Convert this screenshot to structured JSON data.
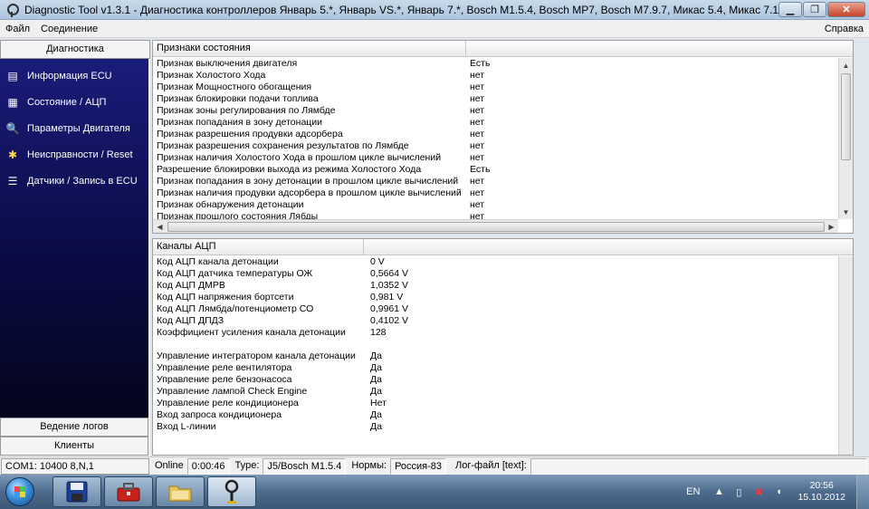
{
  "window": {
    "title": "Diagnostic Tool v1.3.1 - Диагностика контроллеров Январь 5.*, Январь VS.*, Январь 7.*, Bosch M1.5.4, Bosch MP7, Bosch M7.9.7, Микас 5.4, Микас 7.1",
    "minimize": "▁",
    "maximize": "❐",
    "close": "✕"
  },
  "menu": {
    "file": "Файл",
    "connection": "Соединение",
    "help": "Справка"
  },
  "sidebar": {
    "header": "Диагностика",
    "items": [
      {
        "label": "Информация ECU",
        "icon": "info-icon"
      },
      {
        "label": "Состояние / АЦП",
        "icon": "state-icon"
      },
      {
        "label": "Параметры Двигателя",
        "icon": "engine-params-icon"
      },
      {
        "label": "Неисправности / Reset",
        "icon": "faults-icon"
      },
      {
        "label": "Датчики / Запись в ECU",
        "icon": "sensors-icon"
      }
    ],
    "footer": {
      "logs": "Ведение логов",
      "clients": "Клиенты"
    }
  },
  "flags": {
    "header": "Признаки состояния",
    "rows": [
      [
        "Признак выключения двигателя",
        "Есть"
      ],
      [
        "Признак Холостого Хода",
        "нет"
      ],
      [
        "Признак Мощностного обогащения",
        "нет"
      ],
      [
        "Признак блокировки подачи топлива",
        "нет"
      ],
      [
        "Признак зоны регулирования по Лямбде",
        "нет"
      ],
      [
        "Признак попадания в зону детонации",
        "нет"
      ],
      [
        "Признак разрешения продувки адсорбера",
        "нет"
      ],
      [
        "Признак разрешения сохранения результатов по Лямбде",
        "нет"
      ],
      [
        "Признак наличия Холостого Хода в прошлом цикле вычислений",
        "нет"
      ],
      [
        "Разрешение блокировки выхода из режима Холостого Хода",
        "Есть"
      ],
      [
        "Признак попадания в зону детонации в прошлом цикле вычислений",
        "нет"
      ],
      [
        "Признак наличия продувки адсорбера в прошлом цикле вычислений",
        "нет"
      ],
      [
        "Признак обнаружения детонации",
        "нет"
      ],
      [
        "Признак прошлого состояния Лябды",
        "нет"
      ]
    ]
  },
  "adc": {
    "header": "Каналы АЦП",
    "rows": [
      [
        "Код АЦП канала детонации",
        "0 V"
      ],
      [
        "Код АЦП датчика температуры ОЖ",
        "0,5664 V"
      ],
      [
        "Код АЦП ДМРВ",
        "1,0352 V"
      ],
      [
        "Код АЦП напряжения бортсети",
        "0,981 V"
      ],
      [
        "Код АЦП Лямбда/потенциометр СО",
        "0,9961 V"
      ],
      [
        "Код АЦП ДПДЗ",
        "0,4102 V"
      ],
      [
        "Коэффициент усиления канала детонации",
        "128"
      ],
      [
        "",
        ""
      ],
      [
        "Управление интегратором канала детонации",
        "Да"
      ],
      [
        "Управление реле вентилятора",
        "Да"
      ],
      [
        "Управление реле бензонасоса",
        "Да"
      ],
      [
        "Управление лампой Check Engine",
        "Да"
      ],
      [
        "Управление реле кондиционера",
        "Нет"
      ],
      [
        "Вход запроса кондиционера",
        "Да"
      ],
      [
        "Вход L-линии",
        "Да"
      ]
    ]
  },
  "status": {
    "port": "COM1: 10400 8,N,1",
    "online_label": "Online",
    "online_time": "0:00:46",
    "type_label": "Type:",
    "type_value": "J5/Bosch M1.5.4",
    "norms_label": "Нормы:",
    "norms_value": "Россия-83",
    "log_label": "Лог-файл [text]:"
  },
  "taskbar": {
    "apps": [
      "floppy-save-icon",
      "toolbox-icon",
      "folder-icon",
      "diagnostic-tool-icon"
    ],
    "lang": "EN",
    "time": "20:56",
    "date": "15.10.2012"
  }
}
